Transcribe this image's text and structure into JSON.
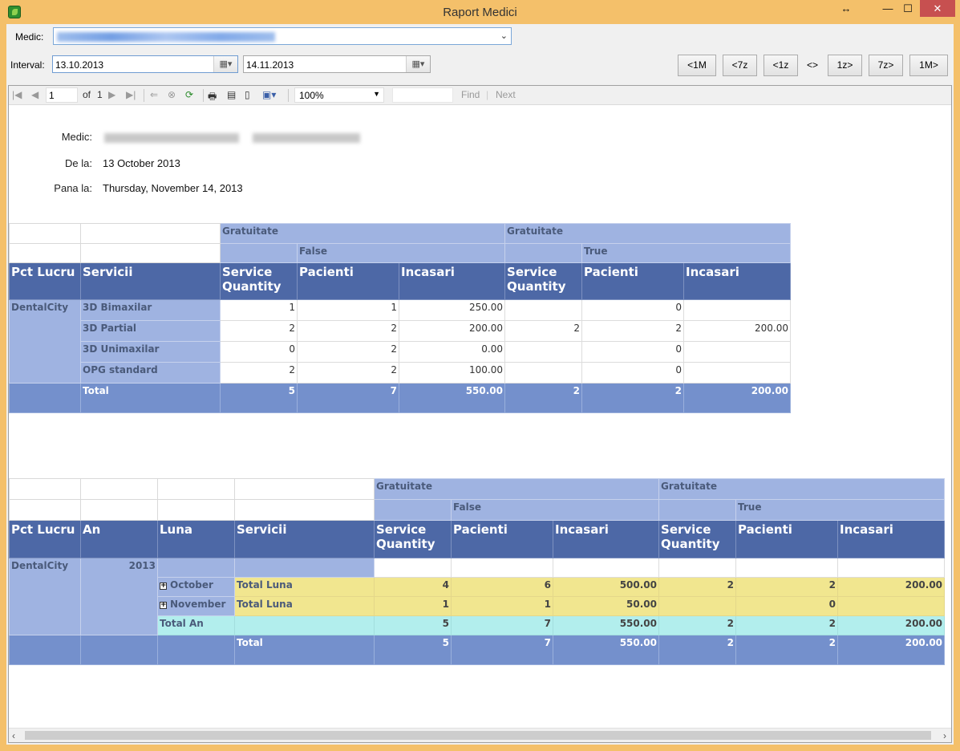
{
  "window": {
    "title": "Raport Medici"
  },
  "filters": {
    "medic_label": "Medic:",
    "interval_label": "Interval:",
    "date_from": "13.10.2013",
    "date_to": "14.11.2013"
  },
  "nav_buttons": [
    "<1M",
    "<7z",
    "<1z",
    "<>",
    "1z>",
    "7z>",
    "1M>"
  ],
  "toolbar": {
    "page_value": "1",
    "of_label": "of",
    "total_pages": "1",
    "zoom": "100%",
    "find_label": "Find",
    "separator": "|",
    "next_label": "Next"
  },
  "report_header": {
    "medic_label": "Medic:",
    "from_label": "De la:",
    "from_value": "13 October 2013",
    "to_label": "Pana la:",
    "to_value": "Thursday, November 14, 2013"
  },
  "pivot1": {
    "group_label": "Gratuitate",
    "false_label": "False",
    "true_label": "True",
    "headers": [
      "Pct Lucru",
      "Servicii",
      "Service Quantity",
      "Pacienti",
      "Incasari",
      "Service Quantity",
      "Pacienti",
      "Incasari"
    ],
    "location": "DentalCity",
    "rows": [
      {
        "service": "3D Bimaxilar",
        "vals": [
          "1",
          "1",
          "250.00",
          "",
          "0",
          ""
        ]
      },
      {
        "service": "3D Partial",
        "vals": [
          "2",
          "2",
          "200.00",
          "2",
          "2",
          "200.00"
        ]
      },
      {
        "service": "3D Unimaxilar",
        "vals": [
          "0",
          "2",
          "0.00",
          "",
          "0",
          ""
        ]
      },
      {
        "service": "OPG standard",
        "vals": [
          "2",
          "2",
          "100.00",
          "",
          "0",
          ""
        ]
      }
    ],
    "total_label": "Total",
    "total": [
      "5",
      "7",
      "550.00",
      "2",
      "2",
      "200.00"
    ]
  },
  "pivot2": {
    "group_label": "Gratuitate",
    "false_label": "False",
    "true_label": "True",
    "headers": [
      "Pct Lucru",
      "An",
      "Luna",
      "Servicii",
      "Service Quantity",
      "Pacienti",
      "Incasari",
      "Service Quantity",
      "Pacienti",
      "Incasari"
    ],
    "location": "DentalCity",
    "year": "2013",
    "months": [
      {
        "name": "October",
        "label": "Total Luna",
        "vals": [
          "4",
          "6",
          "500.00",
          "2",
          "2",
          "200.00"
        ]
      },
      {
        "name": "November",
        "label": "Total Luna",
        "vals": [
          "1",
          "1",
          "50.00",
          "",
          "0",
          ""
        ]
      }
    ],
    "year_total_label": "Total An",
    "year_total": [
      "5",
      "7",
      "550.00",
      "2",
      "2",
      "200.00"
    ],
    "total_label": "Total",
    "total": [
      "5",
      "7",
      "550.00",
      "2",
      "2",
      "200.00"
    ]
  }
}
